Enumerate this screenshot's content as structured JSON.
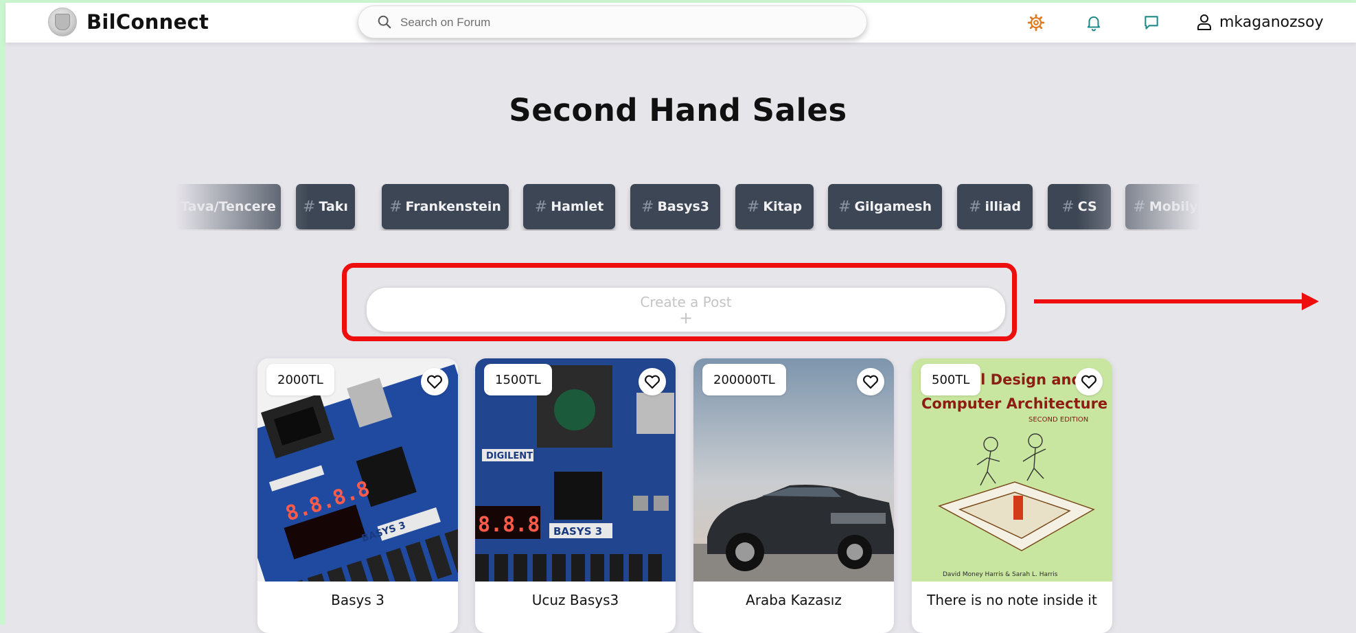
{
  "app": {
    "name": "BilConnect"
  },
  "search": {
    "placeholder": "Search on Forum"
  },
  "header": {
    "username": "mkaganozsoy"
  },
  "page": {
    "title": "Second Hand Sales"
  },
  "tags": [
    "Tava/Tencere",
    "Takı",
    "Frankenstein",
    "Hamlet",
    "Basys3",
    "Kitap",
    "Gilgamesh",
    "illiad",
    "CS",
    "Mobilya"
  ],
  "create_post": {
    "label": "Create a Post",
    "plus": "+"
  },
  "cards": [
    {
      "price": "2000TL",
      "title": "Basys 3"
    },
    {
      "price": "1500TL",
      "title": "Ucuz Basys3"
    },
    {
      "price": "200000TL",
      "title": "Araba Kazasız"
    },
    {
      "price": "500TL",
      "title": "There is no note inside it"
    }
  ],
  "card_images": {
    "basys_brand": "DIGILENT",
    "basys_label": "BASYS 3",
    "display_1": "8.8.8.8",
    "display_2": "8.8.8",
    "book_title_line1": "al Design and",
    "book_title_line2": "Computer Architecture",
    "book_edition": "SECOND EDITION",
    "book_authors": "David Money Harris & Sarah L. Harris"
  },
  "colors": {
    "accent_red": "#ee0e0e",
    "tag_bg": "#3d4654",
    "header_icon_teal": "#1f8a8a",
    "header_icon_orange": "#e07a1f"
  }
}
